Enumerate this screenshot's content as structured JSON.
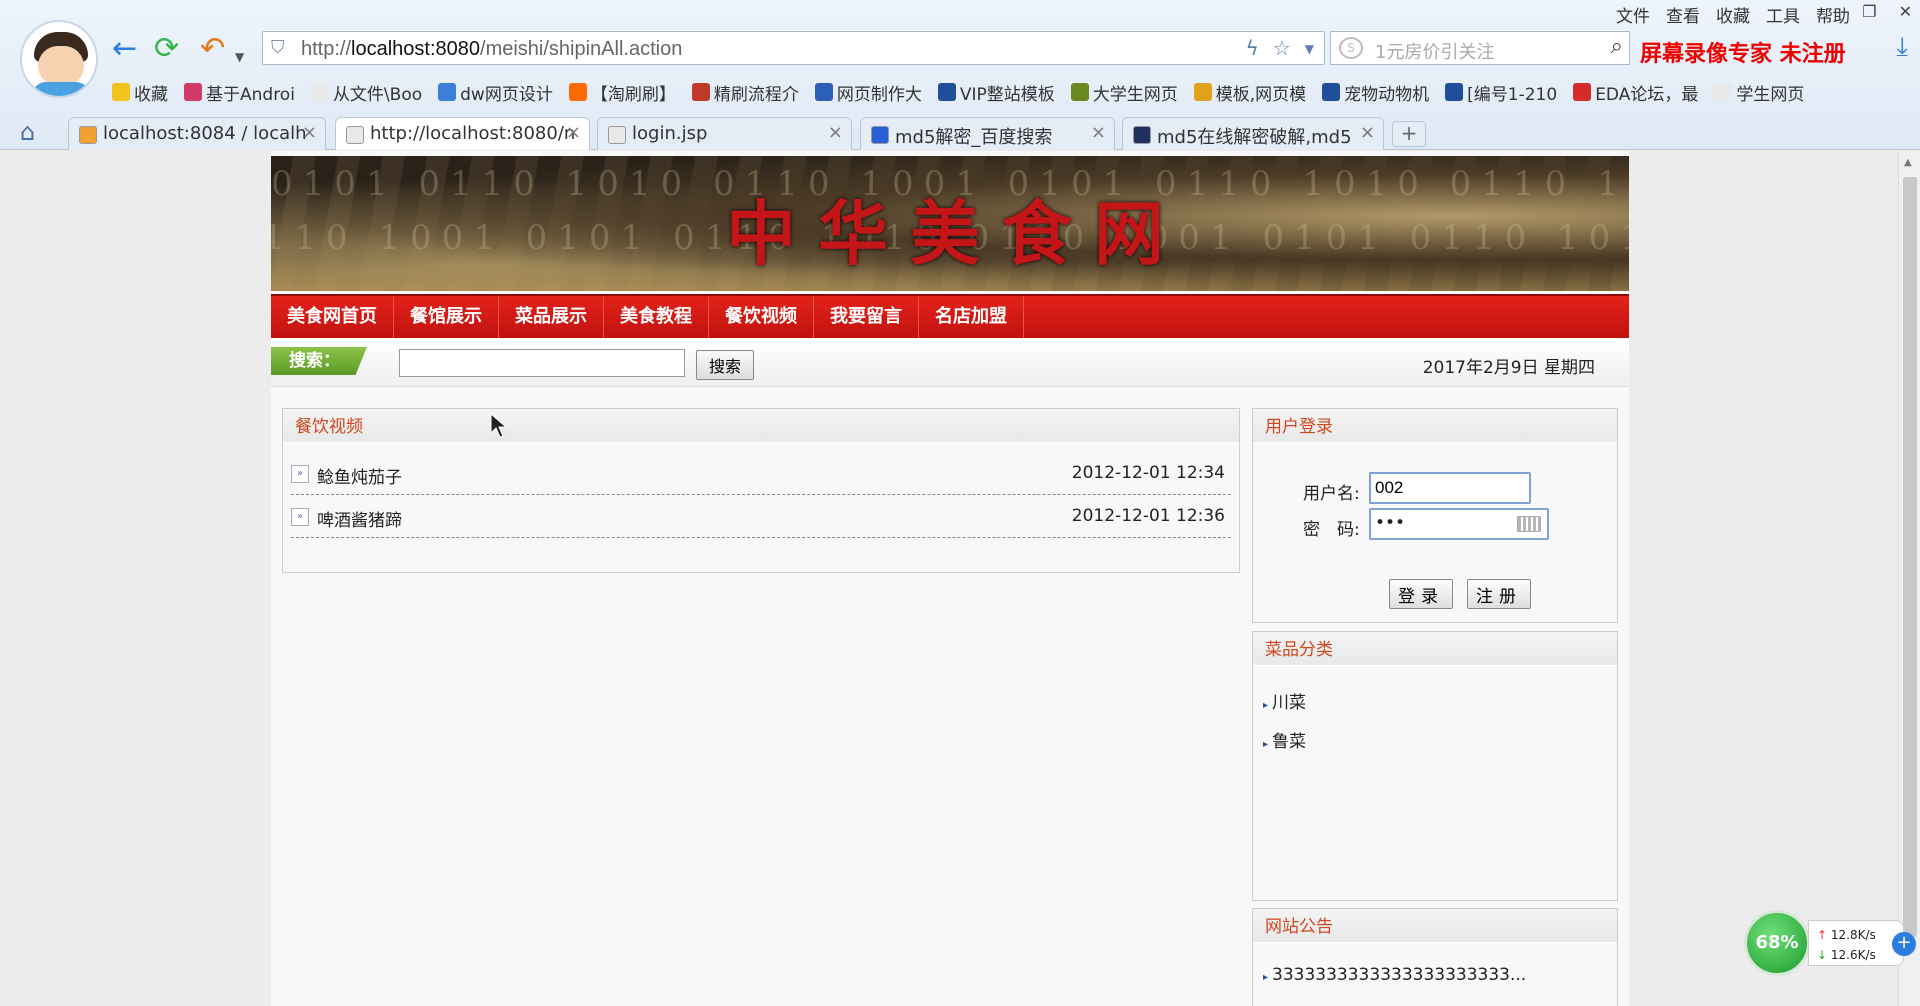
{
  "browser": {
    "top_menu": [
      "文件",
      "查看",
      "收藏",
      "工具",
      "帮助"
    ],
    "address_url_prefix": "http://",
    "address_url_host": "localhost:8080",
    "address_url_path": "/meishi/shipinAll.action",
    "search_placeholder": "1元房价引关注",
    "recorder_watermark": "屏幕录像专家 未注册",
    "bookmarks": [
      {
        "label": "收藏",
        "color": "#f3c21b"
      },
      {
        "label": "基于Androi",
        "color": "#d23a6a"
      },
      {
        "label": "从文件\\Boo",
        "color": "#e9e9e9"
      },
      {
        "label": "dw网页设计",
        "color": "#3b7fd8"
      },
      {
        "label": "【淘刷刷】",
        "color": "#ff6a00"
      },
      {
        "label": "精刷流程介",
        "color": "#c0392b"
      },
      {
        "label": "网页制作大",
        "color": "#2b5fb8"
      },
      {
        "label": "VIP整站模板",
        "color": "#1f4e9b"
      },
      {
        "label": "大学生网页",
        "color": "#6a8a1f"
      },
      {
        "label": "模板,网页模",
        "color": "#e0a21b"
      },
      {
        "label": "宠物动物机",
        "color": "#1f4e9b"
      },
      {
        "label": "[编号1-210",
        "color": "#1f4e9b"
      },
      {
        "label": "EDA论坛，最",
        "color": "#d62b2b"
      },
      {
        "label": "学生网页",
        "color": "#e9e9e9"
      }
    ],
    "tabs": [
      {
        "label": "localhost:8084 / localh",
        "color": "#f0a030",
        "active": false
      },
      {
        "label": "http://localhost:8080/n",
        "color": "#e9e9e9",
        "active": true
      },
      {
        "label": "login.jsp",
        "color": "#e9e9e9",
        "active": false
      },
      {
        "label": "md5解密_百度搜索",
        "color": "#2b5fd8",
        "active": false
      },
      {
        "label": "md5在线解密破解,md5",
        "color": "#203060",
        "active": false
      }
    ]
  },
  "site": {
    "banner_title": "中华美食网",
    "menu": [
      "美食网首页",
      "餐馆展示",
      "菜品展示",
      "美食教程",
      "餐饮视频",
      "我要留言",
      "名店加盟"
    ],
    "search_label": "搜索：",
    "search_button": "搜索",
    "date": "2017年2月9日 星期四",
    "videos_header": "餐饮视频",
    "videos": [
      {
        "title": "鲶鱼炖茄子",
        "time": "2012-12-01 12:34"
      },
      {
        "title": "啤酒酱猪蹄",
        "time": "2012-12-01 12:36"
      }
    ],
    "login": {
      "header": "用户登录",
      "username_label": "用户名:",
      "username_value": "002",
      "password_label": "密　码:",
      "password_value": "•••",
      "login_button": "登录",
      "register_button": "注册"
    },
    "categories_header": "菜品分类",
    "categories": [
      "川菜",
      "鲁菜"
    ],
    "notice_header": "网站公告",
    "notices": [
      "3333333333333333333333..."
    ]
  },
  "speed_widget": {
    "percent": "68%",
    "up": "12.8K/s",
    "down": "12.6K/s"
  }
}
